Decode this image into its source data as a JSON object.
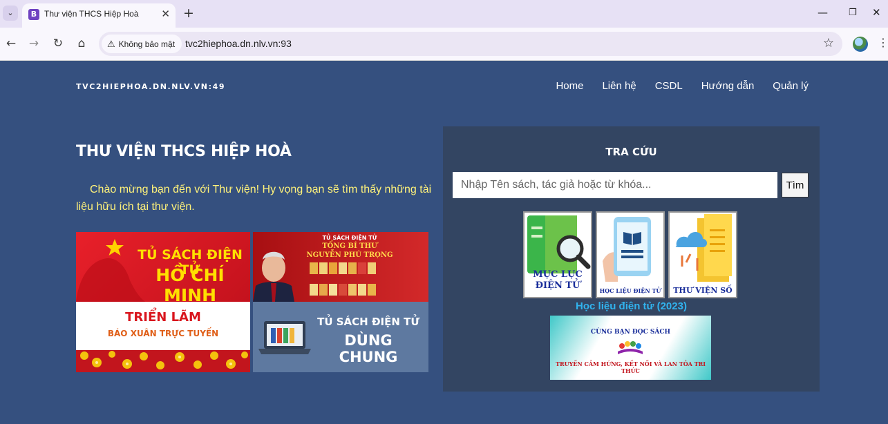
{
  "browser": {
    "tab_title": "Thư viện THCS Hiệp Hoà",
    "security_label": "Không bảo mật",
    "url": "tvc2hiephoa.dn.nlv.vn:93"
  },
  "site": {
    "brand": "TVC2HIEPHOA.DN.NLV.VN:49",
    "nav": [
      "Home",
      "Liên hệ",
      "CSDL",
      "Hướng dẫn",
      "Quản lý"
    ],
    "title": "THƯ VIỆN THCS HIỆP HOÀ",
    "welcome": "Chào mừng bạn đến với Thư viện! Hy vọng bạn sẽ tìm thấy những tài liệu hữu ích tại thư viện."
  },
  "banners": {
    "hcm": [
      "TỦ SÁCH ĐIỆN TỬ",
      "HỒ CHÍ MINH"
    ],
    "tbt": [
      "TỦ SÁCH ĐIỆN TỬ",
      "TỔNG BÍ THƯ",
      "NGUYỄN PHÚ TRỌNG"
    ],
    "trienlam": [
      "TRIỂN LÃM",
      "BÁO XUÂN TRỰC TUYẾN"
    ],
    "dungchung": [
      "TỦ SÁCH ĐIỆN TỬ",
      "DÙNG CHUNG"
    ]
  },
  "search": {
    "title": "TRA CỨU",
    "placeholder": "Nhập Tên sách, tác giả hoặc từ khóa...",
    "button": "Tìm"
  },
  "tiles": {
    "mucluc": [
      "MỤC LỤC",
      "ĐIỆN TỬ"
    ],
    "hoclieu": "HỌC LIỆU ĐIỆN TỬ",
    "thuvienso": "THƯ VIỆN SỐ"
  },
  "hoclieu_link": "Học liệu điện tử (2023)",
  "reading": {
    "title": "CÙNG BẠN ĐỌC SÁCH",
    "subtitle": "TRUYỀN CẢM HỨNG, KẾT NỐI VÀ LAN TỎA TRI THỨC"
  }
}
